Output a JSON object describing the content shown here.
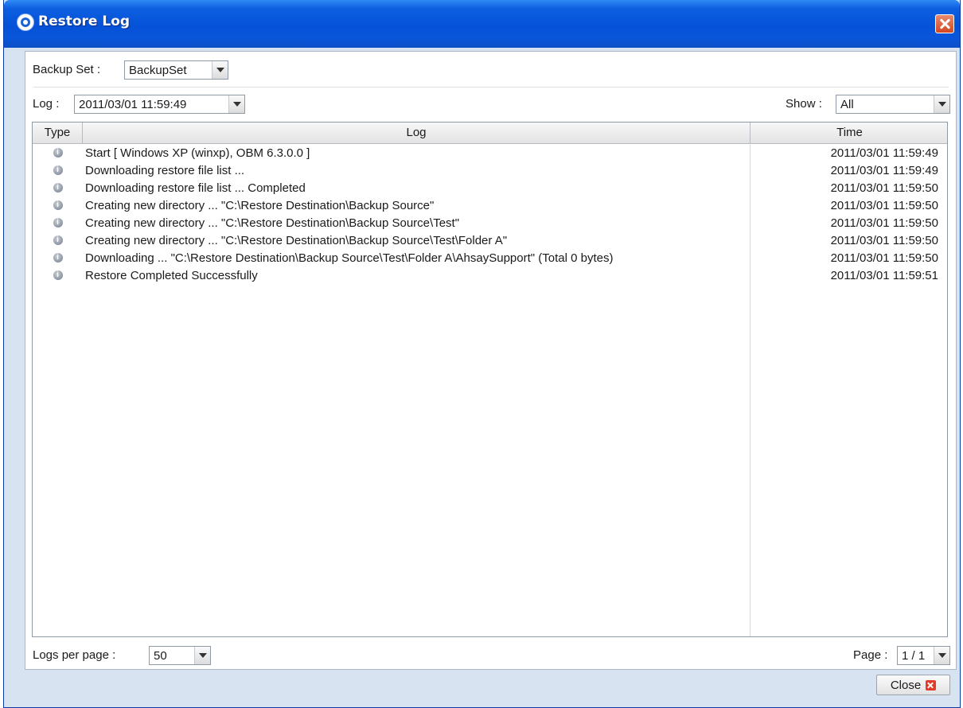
{
  "window": {
    "title": "Restore Log"
  },
  "filters": {
    "backup_set_label": "Backup Set :",
    "backup_set_value": "BackupSet",
    "log_label": "Log :",
    "log_value": "2011/03/01 11:59:49",
    "show_label": "Show :",
    "show_value": "All"
  },
  "table": {
    "columns": [
      "Type",
      "Log",
      "Time"
    ],
    "rows": [
      {
        "type_icon": "info-icon",
        "log": "Start [ Windows XP (winxp), OBM 6.3.0.0 ]",
        "time": "2011/03/01 11:59:49"
      },
      {
        "type_icon": "info-icon",
        "log": "Downloading restore file list ...",
        "time": "2011/03/01 11:59:49"
      },
      {
        "type_icon": "info-icon",
        "log": "Downloading restore file list ... Completed",
        "time": "2011/03/01 11:59:50"
      },
      {
        "type_icon": "info-icon",
        "log": "Creating new directory ... \"C:\\Restore Destination\\Backup Source\"",
        "time": "2011/03/01 11:59:50"
      },
      {
        "type_icon": "info-icon",
        "log": "Creating new directory ... \"C:\\Restore Destination\\Backup Source\\Test\"",
        "time": "2011/03/01 11:59:50"
      },
      {
        "type_icon": "info-icon",
        "log": "Creating new directory ... \"C:\\Restore Destination\\Backup Source\\Test\\Folder A\"",
        "time": "2011/03/01 11:59:50"
      },
      {
        "type_icon": "info-icon",
        "log": "Downloading ... \"C:\\Restore Destination\\Backup Source\\Test\\Folder A\\AhsaySupport\" (Total 0 bytes)",
        "time": "2011/03/01 11:59:50"
      },
      {
        "type_icon": "info-icon",
        "log": "Restore Completed Successfully",
        "time": "2011/03/01 11:59:51"
      }
    ]
  },
  "footer": {
    "logs_per_page_label": "Logs per page :",
    "logs_per_page_value": "50",
    "page_label": "Page :",
    "page_value": "1 / 1"
  },
  "buttons": {
    "close_label": "Close"
  }
}
